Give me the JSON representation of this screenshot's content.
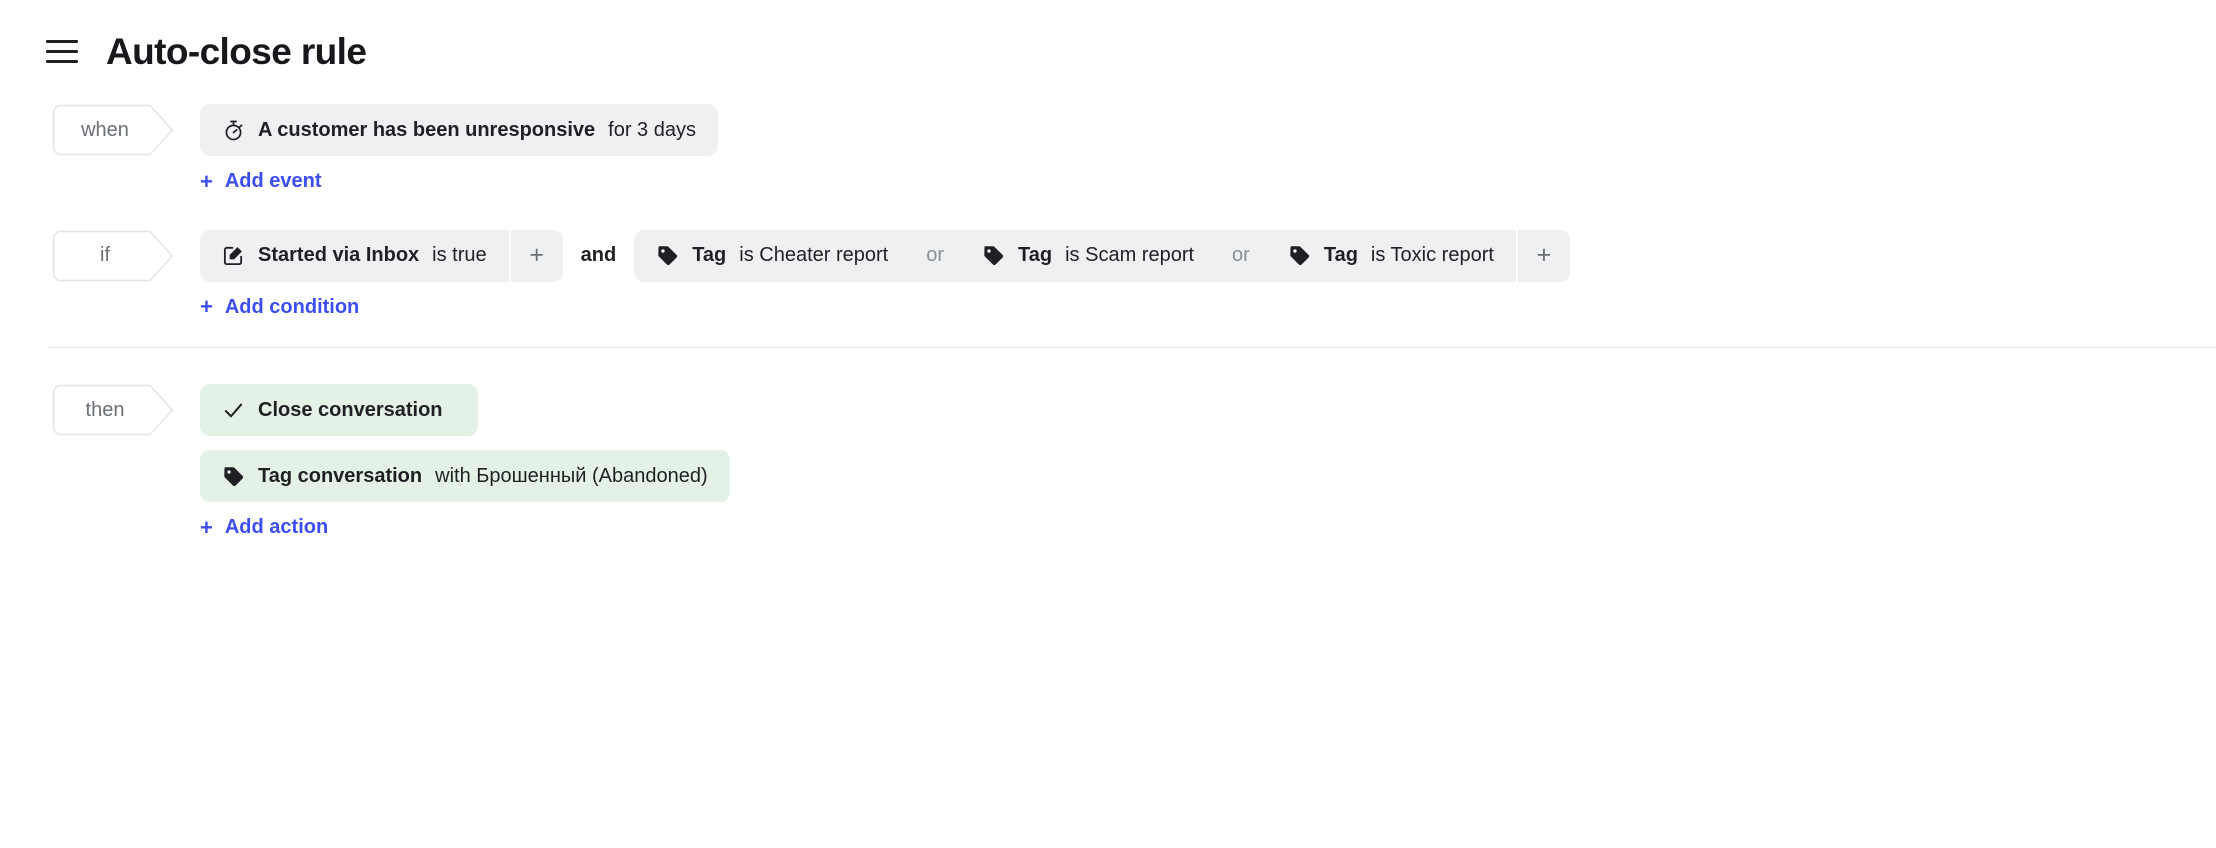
{
  "header": {
    "menu_icon": "hamburger-menu-icon",
    "title": "Auto-close rule"
  },
  "rule": {
    "when": {
      "label": "when",
      "events": [
        {
          "icon": "stopwatch-icon",
          "bold": "A customer has been unresponsive",
          "rest": "for 3 days"
        }
      ],
      "add_link": {
        "plus": "+",
        "label": "Add event"
      }
    },
    "if": {
      "label": "if",
      "groups": [
        {
          "joiner_after": "and",
          "conditions": [
            {
              "icon": "edit-square-icon",
              "bold": "Started via Inbox",
              "rest": "is true"
            }
          ],
          "add_button": "+"
        },
        {
          "joiner_after": "",
          "inner_joiner": "or",
          "conditions": [
            {
              "icon": "tag-icon",
              "bold": "Tag",
              "rest": "is Cheater report"
            },
            {
              "icon": "tag-icon",
              "bold": "Tag",
              "rest": "is Scam report"
            },
            {
              "icon": "tag-icon",
              "bold": "Tag",
              "rest": "is Toxic report"
            }
          ],
          "add_button": "+"
        }
      ],
      "add_link": {
        "plus": "+",
        "label": "Add condition"
      }
    },
    "then": {
      "label": "then",
      "actions": [
        {
          "icon": "check-icon",
          "bold": "Close conversation",
          "rest": ""
        },
        {
          "icon": "tag-icon",
          "bold": "Tag conversation",
          "rest": "with Брошенный (Abandoned)"
        }
      ],
      "add_link": {
        "plus": "+",
        "label": "Add action"
      }
    }
  },
  "colors": {
    "chip_grey": "#eff0f1",
    "chip_green": "#e4f1e6",
    "link_blue": "#3d4ef5",
    "muted": "#6b7075"
  }
}
